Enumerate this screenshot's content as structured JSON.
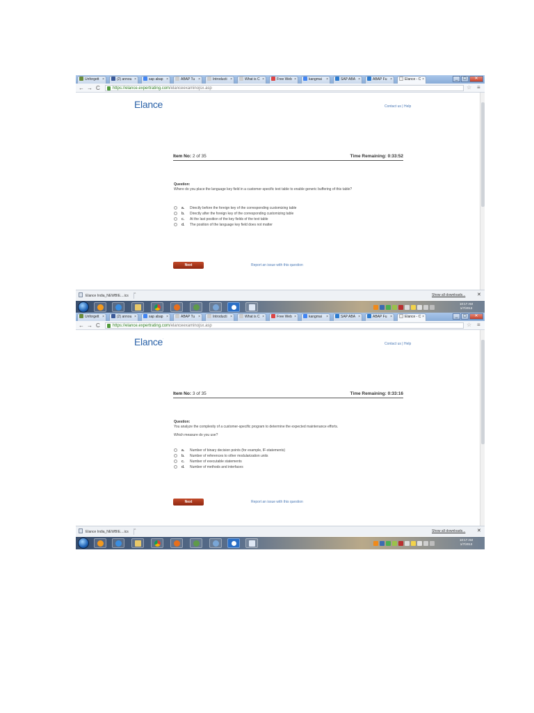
{
  "browser": {
    "tabs": [
      "Unforgett",
      "(2) annou",
      "sap abap",
      "ABAP Tu",
      "Introducti",
      "What is C",
      "Free Web",
      "kangmai",
      "SAP ABA",
      "ABAP Fu",
      "Elance - C"
    ],
    "url_host": "https://elance.expertrating.com",
    "url_path": "/elanceexaminojsx.asp",
    "nav_back": "←",
    "nav_forward": "→",
    "nav_reload": "C",
    "star": "☆",
    "menu": "≡"
  },
  "page": {
    "logo": "Elance",
    "logo_mark": "·",
    "contact": "Contact us | Help",
    "item_label": "Item No:",
    "question_label": "Question:",
    "next_label": "Next",
    "report_link": "Report an issue with this question"
  },
  "screens": [
    {
      "item_value": "2 of 35",
      "time_remaining": "Time Remaining: 0:33:52",
      "question_lines": [
        "Where do you place the language key field in a customer-specific text table to enable generic buffering of this table?"
      ],
      "options": [
        {
          "letter": "a.",
          "text": "Directly before the foreign key of the corresponding customizing table"
        },
        {
          "letter": "b.",
          "text": "Directly after the foreign key of the corresponding customizing table"
        },
        {
          "letter": "c.",
          "text": "At the last position of the key fields of the text table"
        },
        {
          "letter": "d.",
          "text": "The position of the language key field does not matter"
        }
      ]
    },
    {
      "item_value": "3 of 35",
      "time_remaining": "Time Remaining: 0:33:16",
      "question_lines": [
        "You analyze the complexity of a customer-specific program to determine the expected maintenance efforts.",
        "Which measure do you use?"
      ],
      "options": [
        {
          "letter": "a.",
          "text": "Number of binary decision points (for example, IF-statements)"
        },
        {
          "letter": "b.",
          "text": "Number of references to other modularization units"
        },
        {
          "letter": "c.",
          "text": "Number of executable statements"
        },
        {
          "letter": "d.",
          "text": "Number of methods and interfaces"
        }
      ]
    }
  ],
  "downloads": {
    "item": "Elance India_NEWBIE....ics",
    "caret": "^",
    "show_all": "Show all downloads...",
    "close": "✕"
  },
  "taskbar": {
    "clock_time": "10:17 AM",
    "clock_date": "1/7/2013"
  },
  "colors": {
    "logo_blue": "#2a62a8",
    "next_button": "#b23a1d",
    "link_blue": "#4a78b5"
  }
}
